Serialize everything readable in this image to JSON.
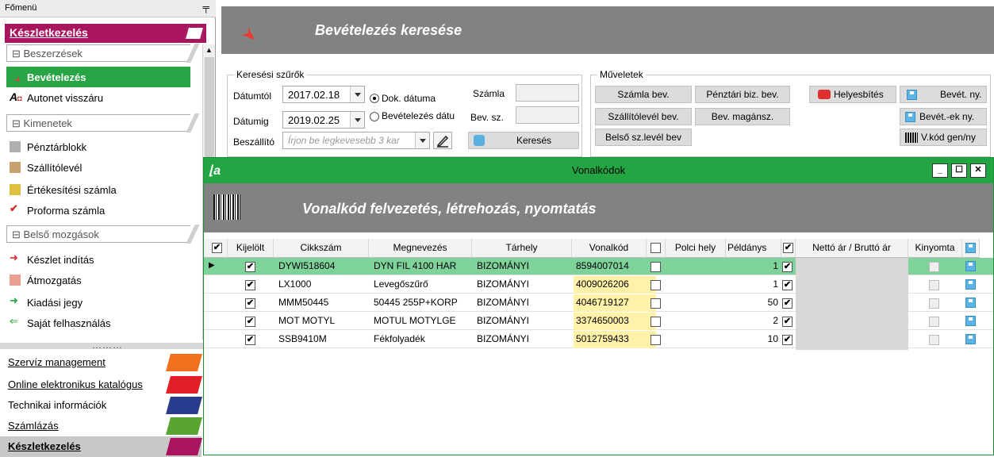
{
  "sidebar": {
    "title": "Főmenü",
    "pin": "ꟷ",
    "module_header": "Készletkezelés",
    "groups": [
      "Beszerzések",
      "Kimenetek",
      "Belső mozgások"
    ],
    "beszerzesek_items": [
      {
        "label": "Bevételezés",
        "active": true
      },
      {
        "label": "Autonet visszáru"
      }
    ],
    "kimenetek_items": [
      {
        "label": "Pénztárblokk"
      },
      {
        "label": "Szállítólevél"
      },
      {
        "label": "Értékesítési számla"
      },
      {
        "label": "Proforma számla"
      }
    ],
    "belso_items": [
      {
        "label": "Készlet indítás"
      },
      {
        "label": "Átmozgatás"
      },
      {
        "label": "Kiadási jegy"
      },
      {
        "label": "Saját felhasználás"
      }
    ],
    "splitter": "………",
    "nav": [
      {
        "label": "Szervíz management",
        "color": "#f0701e"
      },
      {
        "label": "Online elektronikus katalógus",
        "color": "#e21e26"
      },
      {
        "label": "Technikai információk",
        "color": "#2a3c8e"
      },
      {
        "label": "Számlázás",
        "color": "#5aa532"
      },
      {
        "label": "Készletkezelés",
        "color": "#a9145f",
        "bold": true
      }
    ]
  },
  "header": {
    "title": "Bevételezés keresése"
  },
  "search": {
    "legend": "Keresési szűrők",
    "datumtol_label": "Dátumtól",
    "datumtol_value": "2017.02.18",
    "datumig_label": "Dátumig",
    "datumig_value": "2019.02.25",
    "radio_dok": "Dok. dátuma",
    "radio_bev": "Bevételezés dátu",
    "szamla_label": "Számla",
    "bevsz_label": "Bev. sz.",
    "beszallito_label": "Beszállító",
    "beszallito_placeholder": "Írjon be legkevesebb 3 kar",
    "search_button": "Keresés"
  },
  "muveletek": {
    "legend": "Műveletek",
    "buttons": {
      "szamla_bev": "Számla bev.",
      "penztari": "Pénztári biz. bev.",
      "helyesbites": "Helyesbítés",
      "bevet_ny": "Bevét. ny.",
      "szallito_bev": "Szállítólevél bev.",
      "bev_magansz": "Bev. magánsz.",
      "bevetek_ny": "Bevét.-ek ny.",
      "belso_sz": "Belső sz.levél bev",
      "vkod": "V.kód gen/ny"
    }
  },
  "vonalkod_window": {
    "title": "Vonalkódok",
    "logo": "l̲a",
    "heading": "Vonalkód felvezetés, létrehozás, nyomtatás",
    "columns": {
      "kijelolt": "Kijelölt",
      "cikkszam": "Cikkszám",
      "megnevezes": "Megnevezés",
      "tarhely": "Tárhely",
      "vonalkod": "Vonalkód",
      "polci": "Polci hely",
      "peldanys": "Példánys",
      "netto": "Nettó ár / Bruttó ár",
      "kinyomta": "Kinyomta"
    },
    "rows": [
      {
        "cikkszam": "DYWI518604",
        "megnevezes": "DYN FIL 4100 HAR",
        "tarhely": "BIZOMÁNYI",
        "vonalkod": "8594007014",
        "peldany": "1"
      },
      {
        "cikkszam": "LX1000",
        "megnevezes": "Levegőszűrő",
        "tarhely": "BIZOMÁNYI",
        "vonalkod": "4009026206",
        "peldany": "1"
      },
      {
        "cikkszam": "MMM50445",
        "megnevezes": "50445 255P+KORP",
        "tarhely": "BIZOMÁNYI",
        "vonalkod": "4046719127",
        "peldany": "50"
      },
      {
        "cikkszam": "MOT MOTYL",
        "megnevezes": "MOTUL MOTYLGE",
        "tarhely": "BIZOMÁNYI",
        "vonalkod": "3374650003",
        "peldany": "2"
      },
      {
        "cikkszam": "SSB9410M",
        "megnevezes": "Fékfolyadék",
        "tarhely": "BIZOMÁNYI",
        "vonalkod": "5012759433",
        "peldany": "10"
      }
    ]
  },
  "colors": {
    "green": "#23a543",
    "header_gray": "#828282",
    "module": "#a9145f"
  }
}
